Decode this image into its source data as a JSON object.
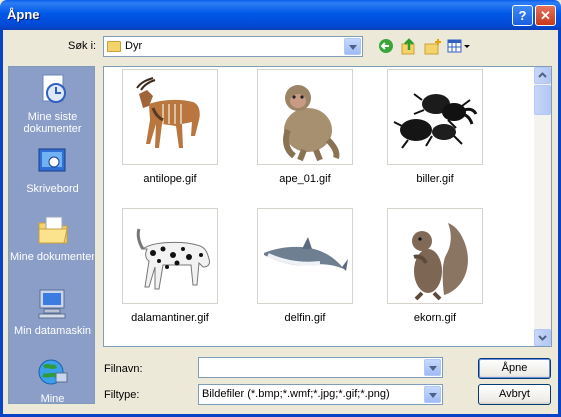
{
  "window": {
    "title": "Åpne"
  },
  "title_buttons": {
    "help": "?",
    "close": "✕"
  },
  "look_in": {
    "label": "Søk i:",
    "value": "Dyr"
  },
  "places": [
    {
      "icon": "recent-documents-icon",
      "label": "Mine siste dokumenter"
    },
    {
      "icon": "desktop-icon",
      "label": "Skrivebord"
    },
    {
      "icon": "my-documents-icon",
      "label": "Mine dokumenter"
    },
    {
      "icon": "my-computer-icon",
      "label": "Min datamaskin"
    },
    {
      "icon": "network-icon",
      "label": "Mine"
    }
  ],
  "files": [
    {
      "name": "antilope.gif",
      "icon": "antelope-thumbnail"
    },
    {
      "name": "ape_01.gif",
      "icon": "monkey-thumbnail"
    },
    {
      "name": "biller.gif",
      "icon": "beetles-thumbnail"
    },
    {
      "name": "dalamantiner.gif",
      "icon": "dalmatian-thumbnail"
    },
    {
      "name": "delfin.gif",
      "icon": "dolphin-thumbnail"
    },
    {
      "name": "ekorn.gif",
      "icon": "squirrel-thumbnail"
    }
  ],
  "filename": {
    "label": "Filnavn:",
    "value": ""
  },
  "filetype": {
    "label": "Filtype:",
    "value": "Bildefiler (*.bmp;*.wmf;*.jpg;*.gif;*.png)"
  },
  "buttons": {
    "open": "Åpne",
    "cancel": "Avbryt"
  }
}
